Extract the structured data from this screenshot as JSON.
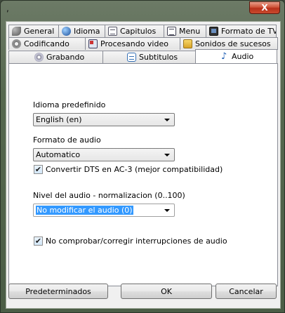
{
  "window": {
    "title": ",",
    "close_symbol": "X"
  },
  "tabs": {
    "row1": [
      {
        "label": "General",
        "icon": "wrench-icon"
      },
      {
        "label": "Idioma",
        "icon": "globe-icon"
      },
      {
        "label": "Capitulos",
        "icon": "document-icon"
      },
      {
        "label": "Menu",
        "icon": "menu-icon"
      },
      {
        "label": "Formato de TV",
        "icon": "tv-icon"
      }
    ],
    "row2": [
      {
        "label": "Codificando",
        "icon": "gear-icon"
      },
      {
        "label": "Procesando video",
        "icon": "processing-icon"
      },
      {
        "label": "Sonidos de sucesos",
        "icon": "folder-icon"
      }
    ],
    "row3": [
      {
        "label": "Grabando",
        "icon": "disc-icon"
      },
      {
        "label": "Subtitulos",
        "icon": "subtitles-icon"
      },
      {
        "label": "Audio",
        "icon": "music-note-icon",
        "active": true
      }
    ]
  },
  "audio": {
    "language_label": "Idioma predefinido",
    "language_value": "English (en)",
    "format_label": "Formato de audio",
    "format_value": "Automatico",
    "dts_checkbox_label": "Convertir DTS en AC-3 (mejor compatibilidad)",
    "dts_checked": true,
    "level_label": "Nivel del audio - normalizacion (0..100)",
    "level_value": "No modificar el audio (0)",
    "interrupt_checkbox_label": "No comprobar/corregir interrupciones de audio",
    "interrupt_checked": true
  },
  "buttons": {
    "defaults": "Predeterminados",
    "ok": "OK",
    "cancel": "Cancelar"
  },
  "check_glyph": "✔",
  "note_glyph": "♪"
}
